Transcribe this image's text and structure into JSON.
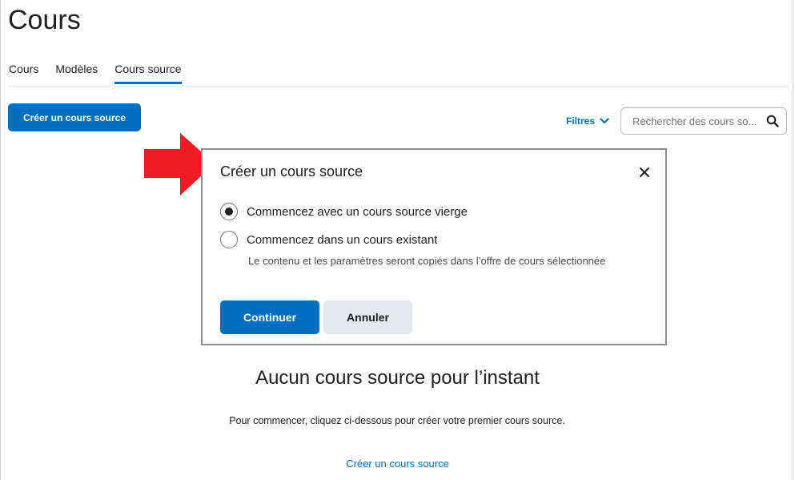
{
  "page": {
    "title": "Cours"
  },
  "tabs": [
    {
      "label": "Cours",
      "active": false
    },
    {
      "label": "Modèles",
      "active": false
    },
    {
      "label": "Cours source",
      "active": true
    }
  ],
  "toolbar": {
    "create_button": "Créer un cours source",
    "filters_label": "Filtres",
    "filters_icon": "chevron-down-icon"
  },
  "search": {
    "placeholder": "Rechercher des cours so...",
    "icon": "search-icon"
  },
  "annotation": {
    "arrow_color": "#ee1c24"
  },
  "dialog": {
    "title": "Créer un cours source",
    "close_icon": "close-icon",
    "options": [
      {
        "label": "Commencez avec un cours source vierge",
        "checked": true
      },
      {
        "label": "Commencez dans un cours existant",
        "checked": false
      }
    ],
    "helper_text": "Le contenu et les paramètres seront copiés dans l’offre de cours sélectionnée",
    "continue_label": "Continuer",
    "cancel_label": "Annuler"
  },
  "empty_state": {
    "title": "Aucun cours source pour l’instant",
    "text": "Pour commencer, cliquez ci-dessous pour créer votre premier cours source.",
    "link": "Créer un cours source"
  },
  "colors": {
    "accent": "#006fbf",
    "secondary_button": "#e3e9f1"
  }
}
